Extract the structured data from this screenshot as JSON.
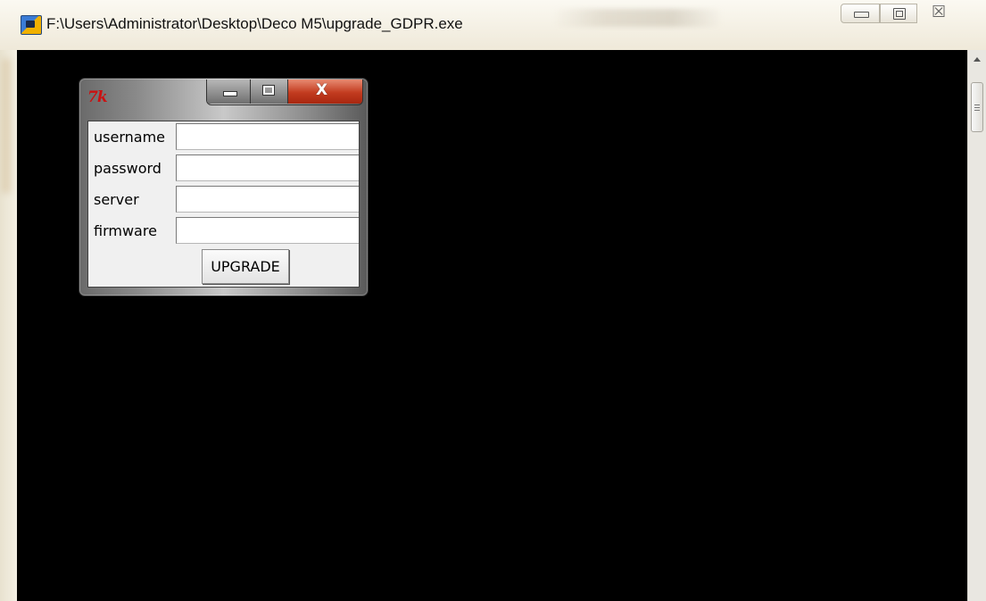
{
  "window": {
    "title": "F:\\Users\\Administrator\\Desktop\\Deco M5\\upgrade_GDPR.exe",
    "icon": "console-app-icon",
    "controls": [
      "minimize-icon",
      "maximize-icon",
      "close-icon"
    ],
    "close_glyph": "☒"
  },
  "dialog": {
    "logo": "7k",
    "controls": [
      "minimize-icon",
      "maximize-icon",
      "close-icon"
    ],
    "close_glyph": "X",
    "fields": [
      {
        "label": "username",
        "value": ""
      },
      {
        "label": "password",
        "value": ""
      },
      {
        "label": "server",
        "value": ""
      },
      {
        "label": "firmware",
        "value": ""
      }
    ],
    "button_label": "UPGRADE"
  },
  "colors": {
    "console_background": "#000000",
    "dialog_close": "#c23b1f",
    "logo": "#cc1111"
  }
}
